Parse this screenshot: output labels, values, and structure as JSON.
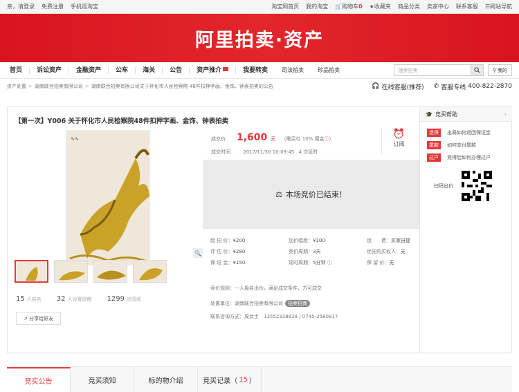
{
  "topbar": {
    "greeting": "亲，请登录",
    "register": "免费注册",
    "mobile": "手机逛淘宝",
    "links": [
      "淘宝网首页",
      "我的淘宝",
      "购物车",
      "收藏夹",
      "商品分类",
      "卖家中心",
      "联系客服",
      "网站导航"
    ],
    "cart_count": "0"
  },
  "banner": {
    "logo": "阿里拍卖·资产"
  },
  "nav": {
    "items": [
      "首页",
      "诉讼资产",
      "金融资产",
      "公车",
      "海关",
      "公告",
      "资产推介",
      "我要转卖"
    ],
    "extra": [
      "司法拍卖",
      "珍品拍卖"
    ],
    "search_placeholder": "搜索拍卖",
    "mine": "我的"
  },
  "breadcrumb": {
    "items": [
      "资产处置",
      "湖南联合拍卖有限公司",
      "湖南联合拍卖有限公司关于怀化市人民检察院 48件扣押字画、金饰、钟表拍卖的公告"
    ]
  },
  "service": {
    "online": "在线客服(推荐)",
    "hotline_label": "客服专线",
    "hotline": "400-822-2870"
  },
  "product": {
    "title": "【第一次】Y006 关于怀化市人民检察院48件扣押字画、金饰、钟表拍卖",
    "price_label": "成交价",
    "price": "1,600",
    "price_unit": "元",
    "commission": "（需另付 10% 佣金",
    "time_label": "成交时间",
    "time": "2017/11/30 10:09:45",
    "delay": "4 次延时",
    "watch": "订阅",
    "ended": "本场竞价已结束！",
    "stats": [
      {
        "num": "15",
        "label": "人报名"
      },
      {
        "num": "32",
        "label": "人设置提醒"
      },
      {
        "num": "1299",
        "label": "次围观"
      }
    ],
    "share": "分享给好友"
  },
  "params": [
    {
      "label": "起 拍 价：",
      "value": "¥200"
    },
    {
      "label": "加价幅度：",
      "value": "¥100"
    },
    {
      "label": "运　　费：",
      "value": "买家自提"
    },
    {
      "label": "评 估 价：",
      "value": "¥280"
    },
    {
      "label": "竞价周期：",
      "value": "3天"
    },
    {
      "label": "优先购买权人：",
      "value": "无"
    },
    {
      "label": "保 证 金：",
      "value": "¥150"
    },
    {
      "label": "延时周期：",
      "value": "5分钟"
    },
    {
      "label": "保 留 价：",
      "value": "无"
    }
  ],
  "info": {
    "rule_label": "竞价规则：",
    "rule": "一人报名出价，满足成交条件，方可成交",
    "org_label": "处置单位：",
    "org": "湖南联合拍卖有限公司",
    "org_tag": "拍卖招商",
    "contact_label": "联系咨询方式：",
    "contact": "周女士　13552328828 / 0745-2580817"
  },
  "side": {
    "title": "竞买帮助",
    "help": [
      {
        "badge": "退保",
        "text": "出局如何退回保证金"
      },
      {
        "badge": "尾款",
        "text": "如何支付尾款"
      },
      {
        "badge": "过户",
        "text": "竞得后如何办理过户"
      }
    ],
    "qr_label": "扫码出价"
  },
  "tabs": [
    {
      "label": "竞买公告"
    },
    {
      "label": "竞买须知"
    },
    {
      "label": "标的物介绍"
    },
    {
      "label": "竞买记录",
      "count": "15"
    }
  ],
  "colors": {
    "brand": "#e4393c",
    "banner": "#d8141e"
  }
}
